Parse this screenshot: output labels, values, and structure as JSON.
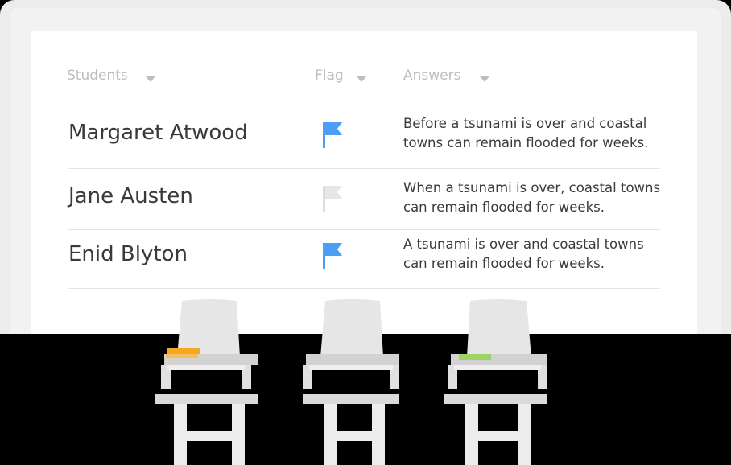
{
  "header": {
    "students_label": "Students",
    "flag_label": "Flag",
    "answers_label": "Answers"
  },
  "rows": [
    {
      "name": "Margaret Atwood",
      "flagged": true,
      "answer_line1": "Before a tsunami is over and coastal",
      "answer_line2": "towns can remain flooded for weeks."
    },
    {
      "name": "Jane Austen",
      "flagged": false,
      "answer_line1": "When a tsunami is over, coastal towns",
      "answer_line2": "can remain flooded for weeks."
    },
    {
      "name": "Enid Blyton",
      "flagged": true,
      "answer_line1": "A tsunami is over and coastal towns",
      "answer_line2": "can remain flooded for weeks."
    }
  ],
  "colors": {
    "flag_active": "#4a9ff5",
    "flag_inactive": "#dcdcdc",
    "book_orange": "#f5a623",
    "book_green": "#9fd36a"
  },
  "illustration": {
    "desks": [
      {
        "name": "desk-with-orange-book",
        "book_color": "#f5a623"
      },
      {
        "name": "desk-empty",
        "book_color": null
      },
      {
        "name": "desk-with-green-book",
        "book_color": "#9fd36a"
      }
    ]
  }
}
